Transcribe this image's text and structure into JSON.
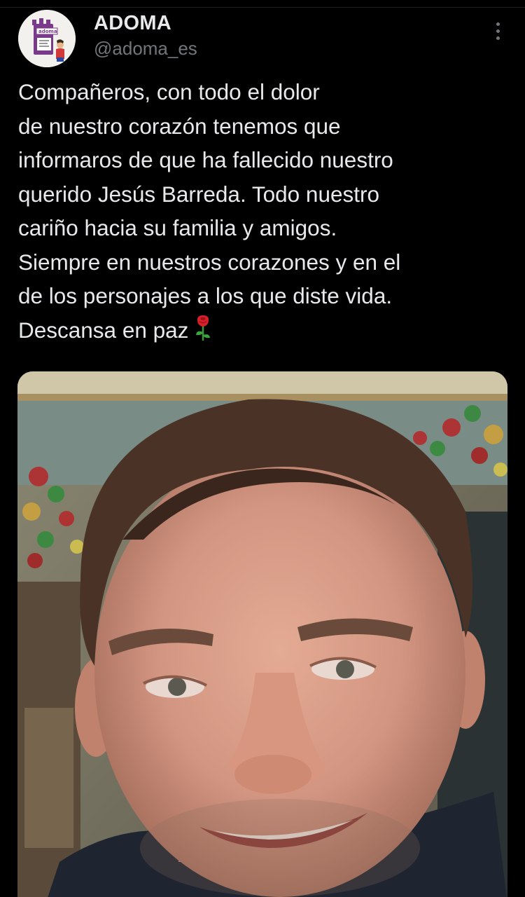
{
  "tweet": {
    "author": {
      "display_name": "ADOMA",
      "handle": "@adoma_es",
      "avatar_icon": "adoma-logo-avatar",
      "avatar_label": "adoma"
    },
    "more_icon": "more-vertical-icon",
    "text_lines": [
      "Compañeros, con todo el dolor",
      "de nuestro corazón tenemos que",
      "informaros de que ha fallecido nuestro",
      "querido Jesús Barreda. Todo nuestro",
      "cariño hacia su familia y amigos.",
      "Siempre en nuestros corazones y en el",
      "de los personajes a los que diste vida.",
      "Descansa en paz"
    ],
    "emoji": "rose-emoji",
    "media": {
      "type": "photo",
      "subject": "portrait-photo"
    }
  },
  "theme": {
    "background": "#000000",
    "text": "#e7e9ea",
    "secondary_text": "#71767b"
  }
}
